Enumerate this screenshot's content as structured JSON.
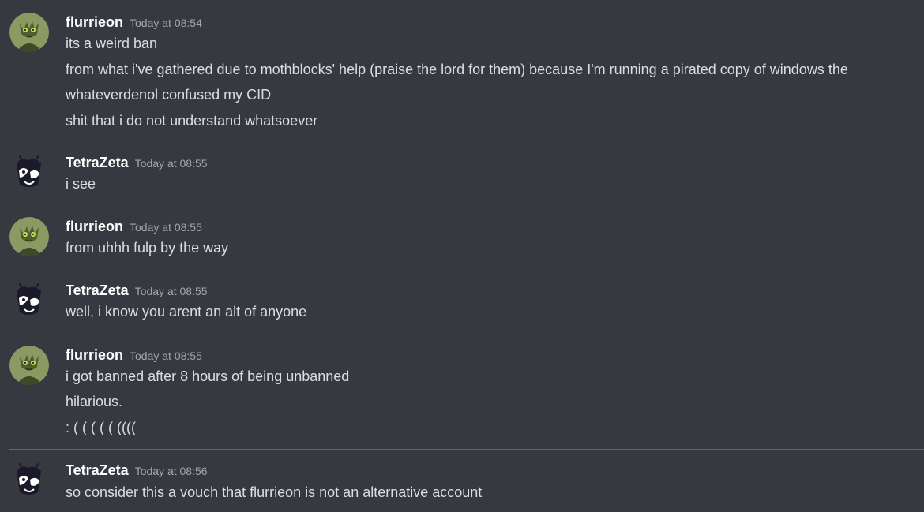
{
  "messages": [
    {
      "author": "flurrieon",
      "timestamp": "Today at 08:54",
      "avatar": "green-creature-avatar",
      "lines": [
        "its a weird ban",
        "from what i've gathered due to mothblocks' help (praise the lord for them) because I'm running a pirated copy of windows the",
        "whateverdenol confused my CID",
        "shit that i do not understand whatsoever"
      ]
    },
    {
      "author": "TetraZeta",
      "timestamp": "Today at 08:55",
      "avatar": "dark-creature-avatar",
      "lines": [
        "i see"
      ]
    },
    {
      "author": "flurrieon",
      "timestamp": "Today at 08:55",
      "avatar": "green-creature-avatar",
      "lines": [
        "from uhhh fulp by the way"
      ]
    },
    {
      "author": "TetraZeta",
      "timestamp": "Today at 08:55",
      "avatar": "dark-creature-avatar",
      "lines": [
        "well, i know you arent an alt of anyone"
      ]
    },
    {
      "author": "flurrieon",
      "timestamp": "Today at 08:55",
      "avatar": "green-creature-avatar",
      "lines": [
        "i got banned after 8 hours of being unbanned",
        "hilarious.",
        ": ( ( ( ( ( (((("
      ]
    },
    {
      "author": "TetraZeta",
      "timestamp": "Today at 08:56",
      "avatar": "dark-creature-avatar",
      "lines": [
        "so consider this a vouch that flurrieon is not an alternative account"
      ]
    }
  ],
  "colors": {
    "background": "#36393f",
    "username": "#ffffff",
    "text": "#dcddde",
    "timestamp": "#a3a6aa",
    "new_divider": "#c43d3d"
  }
}
